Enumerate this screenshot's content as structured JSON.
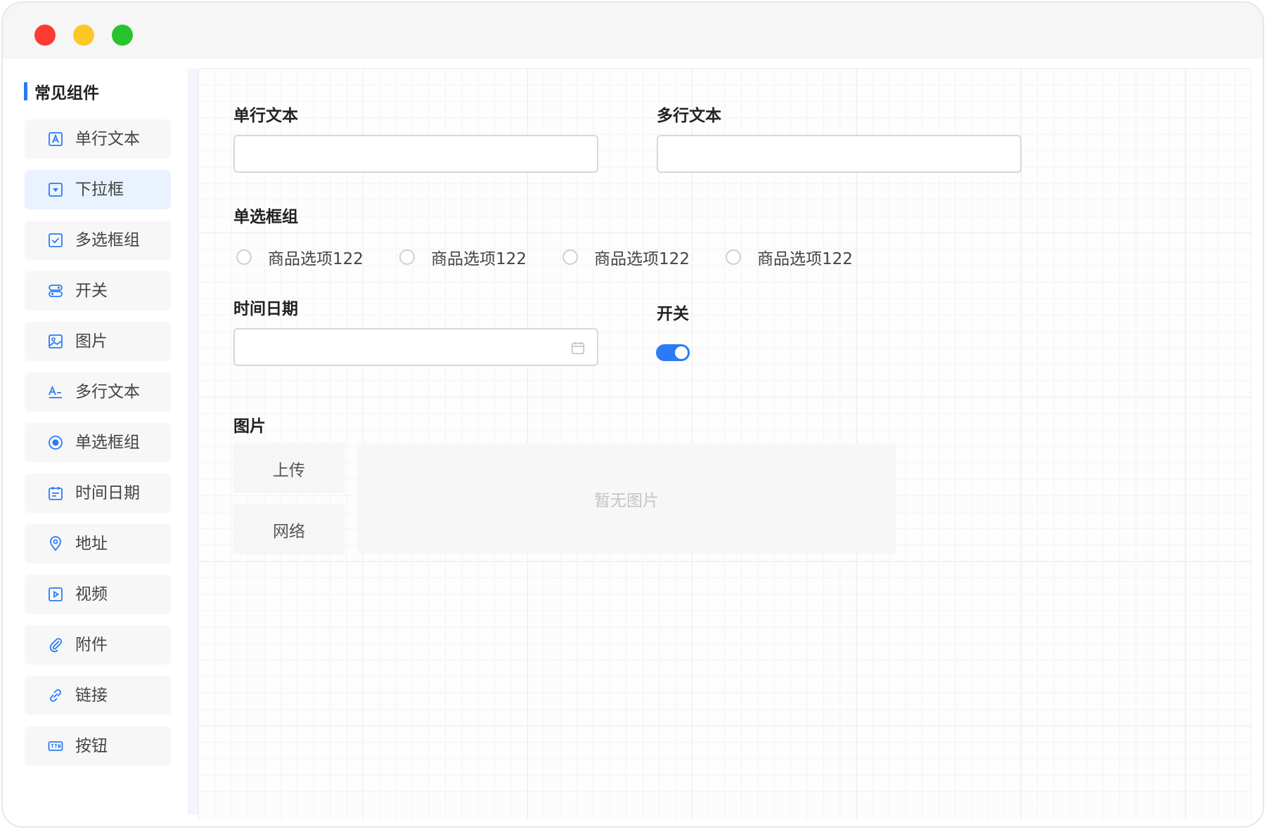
{
  "window": {
    "controls": [
      "close",
      "minimize",
      "maximize"
    ],
    "colors": {
      "close": "#fd3b32",
      "minimize": "#fdc826",
      "maximize": "#27c42e"
    }
  },
  "sidebar": {
    "section_title": "常见组件",
    "accent_color": "#2b7bf6",
    "items": [
      {
        "label": "单行文本",
        "icon": "text-box-icon",
        "active": false
      },
      {
        "label": "下拉框",
        "icon": "dropdown-icon",
        "active": true
      },
      {
        "label": "多选框组",
        "icon": "checkbox-icon",
        "active": false
      },
      {
        "label": "开关",
        "icon": "toggle-icon",
        "active": false
      },
      {
        "label": "图片",
        "icon": "image-icon",
        "active": false
      },
      {
        "label": "多行文本",
        "icon": "multiline-text-icon",
        "active": false
      },
      {
        "label": "单选框组",
        "icon": "radio-icon",
        "active": false
      },
      {
        "label": "时间日期",
        "icon": "calendar-icon",
        "active": false
      },
      {
        "label": "地址",
        "icon": "location-pin-icon",
        "active": false
      },
      {
        "label": "视频",
        "icon": "video-icon",
        "active": false
      },
      {
        "label": "附件",
        "icon": "paperclip-icon",
        "active": false
      },
      {
        "label": "链接",
        "icon": "link-icon",
        "active": false
      },
      {
        "label": "按钮",
        "icon": "button-icon",
        "active": false
      }
    ]
  },
  "form": {
    "single_text": {
      "label": "单行文本",
      "value": "",
      "placeholder": ""
    },
    "multi_text": {
      "label": "多行文本",
      "value": "",
      "placeholder": ""
    },
    "radio_group": {
      "label": "单选框组",
      "options": [
        "商品选项122",
        "商品选项122",
        "商品选项122",
        "商品选项122"
      ],
      "selected": null
    },
    "datetime": {
      "label": "时间日期",
      "value": "",
      "placeholder": ""
    },
    "switch": {
      "label": "开关",
      "on": true,
      "color": "#2b7bf6"
    },
    "image": {
      "label": "图片",
      "upload_label": "上传",
      "network_label": "网络",
      "empty_text": "暂无图片"
    }
  }
}
